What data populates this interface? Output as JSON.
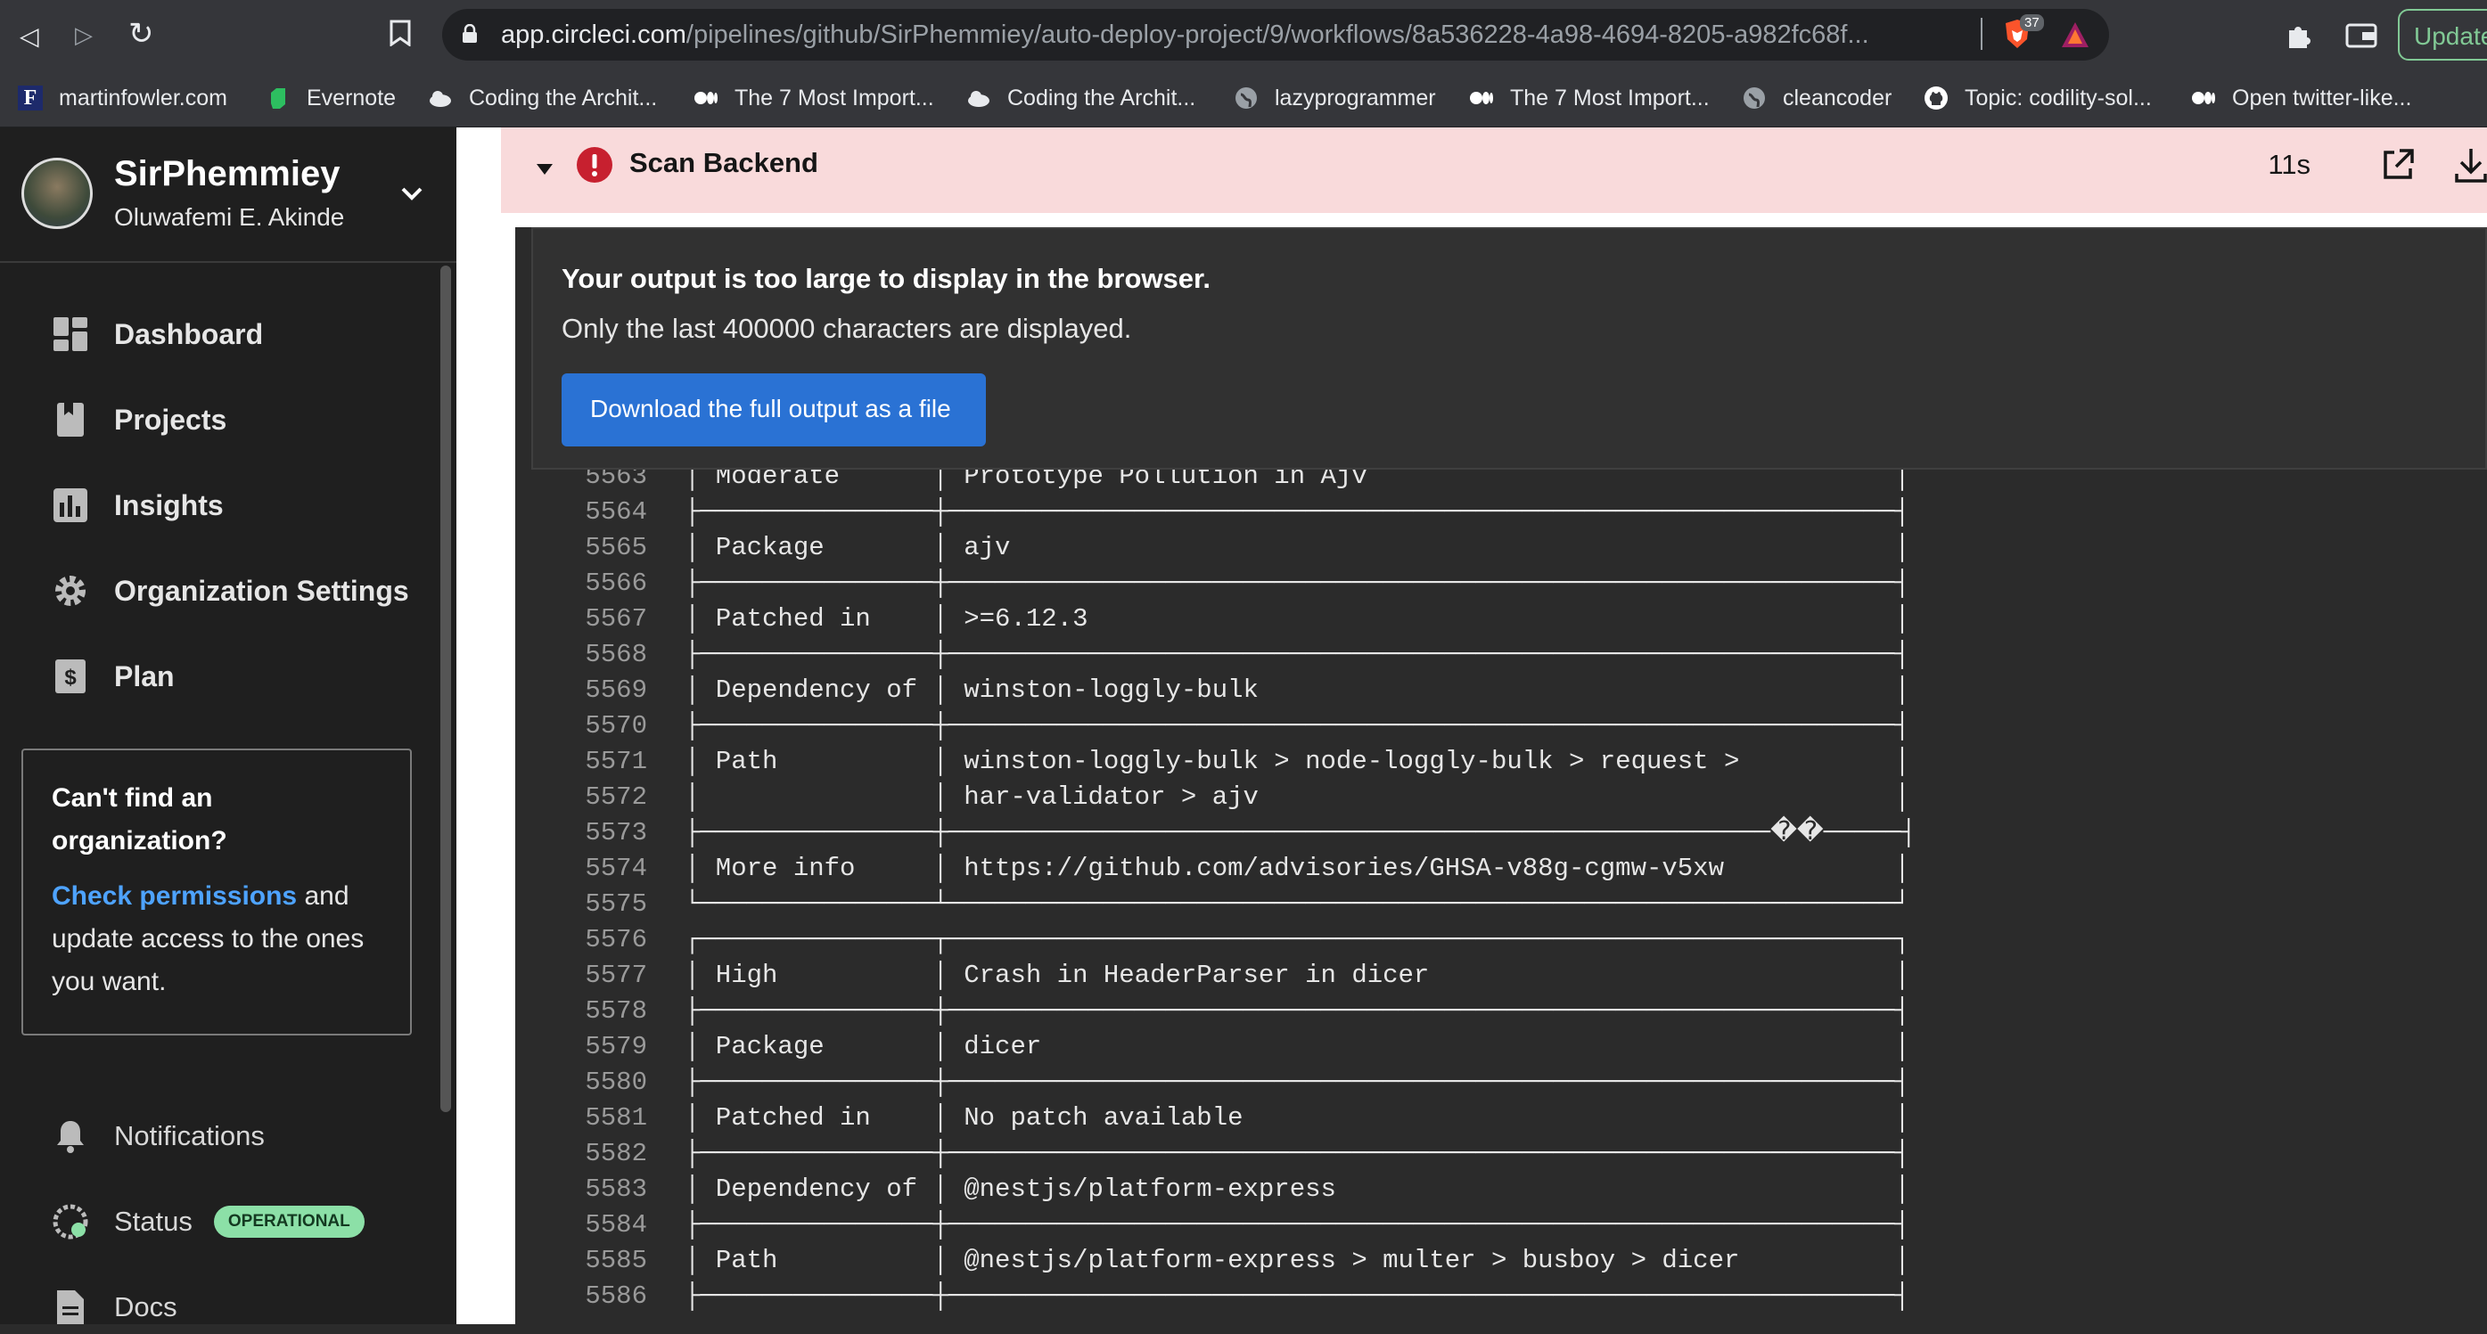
{
  "browser": {
    "url_host": "app.circleci.com",
    "url_path": "/pipelines/github/SirPhemmiey/auto-deploy-project/9/workflows/8a536228-4a98-4694-8205-a982fc68f...",
    "brave_count": "37",
    "update_label": "Update",
    "icons": [
      "back-icon",
      "forward-icon",
      "reload-icon",
      "bookmark-icon",
      "lock-icon",
      "brave-shield-icon",
      "brave-rewards-icon",
      "extensions-icon",
      "wallet-icon"
    ]
  },
  "bookmarks": [
    {
      "label": "martinfowler.com",
      "icon": "martinfowler-icon"
    },
    {
      "label": "Evernote",
      "icon": "evernote-icon"
    },
    {
      "label": "Coding the Archit...",
      "icon": "cloud-icon"
    },
    {
      "label": "The 7 Most Import...",
      "icon": "medium-icon"
    },
    {
      "label": "Coding the Archit...",
      "icon": "cloud-icon"
    },
    {
      "label": "lazyprogrammer",
      "icon": "globe-icon"
    },
    {
      "label": "The 7 Most Import...",
      "icon": "medium-icon"
    },
    {
      "label": "cleancoder",
      "icon": "globe-icon"
    },
    {
      "label": "Topic: codility-sol...",
      "icon": "github-icon"
    },
    {
      "label": "Open twitter-like...",
      "icon": "medium-icon"
    }
  ],
  "sidebar": {
    "org_name": "SirPhemmiey",
    "org_user": "Oluwafemi E. Akinde",
    "nav": [
      {
        "label": "Dashboard",
        "icon": "dashboard-icon"
      },
      {
        "label": "Projects",
        "icon": "projects-icon"
      },
      {
        "label": "Insights",
        "icon": "insights-icon"
      },
      {
        "label": "Organization Settings",
        "icon": "gear-icon"
      },
      {
        "label": "Plan",
        "icon": "plan-icon"
      }
    ],
    "help": {
      "title": "Can't find an organization?",
      "link": "Check permissions",
      "text": " and update access to the ones you want."
    },
    "bottom_nav": [
      {
        "label": "Notifications",
        "icon": "bell-icon"
      },
      {
        "label": "Status",
        "icon": "status-icon",
        "badge": "OPERATIONAL"
      },
      {
        "label": "Docs",
        "icon": "docs-icon"
      }
    ]
  },
  "step": {
    "title": "Scan Backend",
    "duration": "11s",
    "status_color": "#c7202f"
  },
  "output_notice": {
    "title": "Your output is too large to display in the browser.",
    "text": "Only the last 400000 characters are displayed.",
    "button": "Download the full output as a file"
  },
  "log_lines": [
    {
      "n": "5563",
      "t": "│ Moderate      │ Prototype Pollution in Ajv                                  │"
    },
    {
      "n": "5564",
      "t": "├───────────────┼─────────────────────────────────────────────────────────────┤"
    },
    {
      "n": "5565",
      "t": "│ Package       │ ajv                                                         │"
    },
    {
      "n": "5566",
      "t": "├───────────────┼─────────────────────────────────────────────────────────────┤"
    },
    {
      "n": "5567",
      "t": "│ Patched in    │ >=6.12.3                                                    │"
    },
    {
      "n": "5568",
      "t": "├───────────────┼─────────────────────────────────────────────────────────────┤"
    },
    {
      "n": "5569",
      "t": "│ Dependency of │ winston-loggly-bulk                                         │"
    },
    {
      "n": "5570",
      "t": "├───────────────┼─────────────────────────────────────────────────────────────┤"
    },
    {
      "n": "5571",
      "t": "│ Path          │ winston-loggly-bulk > node-loggly-bulk > request >          │"
    },
    {
      "n": "5572",
      "t": "│               │ har-validator > ajv                                         │"
    },
    {
      "n": "5573",
      "t": "├───────────────┼─────────────────────────────────────────────────────��─────┤"
    },
    {
      "n": "5574",
      "t": "│ More info     │ https://github.com/advisories/GHSA-v88g-cgmw-v5xw           │"
    },
    {
      "n": "5575",
      "t": "└───────────────┴─────────────────────────────────────────────────────────────┘"
    },
    {
      "n": "5576",
      "t": "┌───────────────┬─────────────────────────────────────────────────────────────┐"
    },
    {
      "n": "5577",
      "t": "│ High          │ Crash in HeaderParser in dicer                              │"
    },
    {
      "n": "5578",
      "t": "├───────────────┼─────────────────────────────────────────────────────────────┤"
    },
    {
      "n": "5579",
      "t": "│ Package       │ dicer                                                       │"
    },
    {
      "n": "5580",
      "t": "├───────────────┼─────────────────────────────────────────────────────────────┤"
    },
    {
      "n": "5581",
      "t": "│ Patched in    │ No patch available                                          │"
    },
    {
      "n": "5582",
      "t": "├───────────────┼─────────────────────────────────────────────────────────────┤"
    },
    {
      "n": "5583",
      "t": "│ Dependency of │ @nestjs/platform-express                                    │"
    },
    {
      "n": "5584",
      "t": "├───────────────┼─────────────────────────────────────────────────────────────┤"
    },
    {
      "n": "5585",
      "t": "│ Path          │ @nestjs/platform-express > multer > busboy > dicer          │"
    },
    {
      "n": "5586",
      "t": "├───────────────┼─────────────────────────────────────────────────────────────┤"
    }
  ]
}
